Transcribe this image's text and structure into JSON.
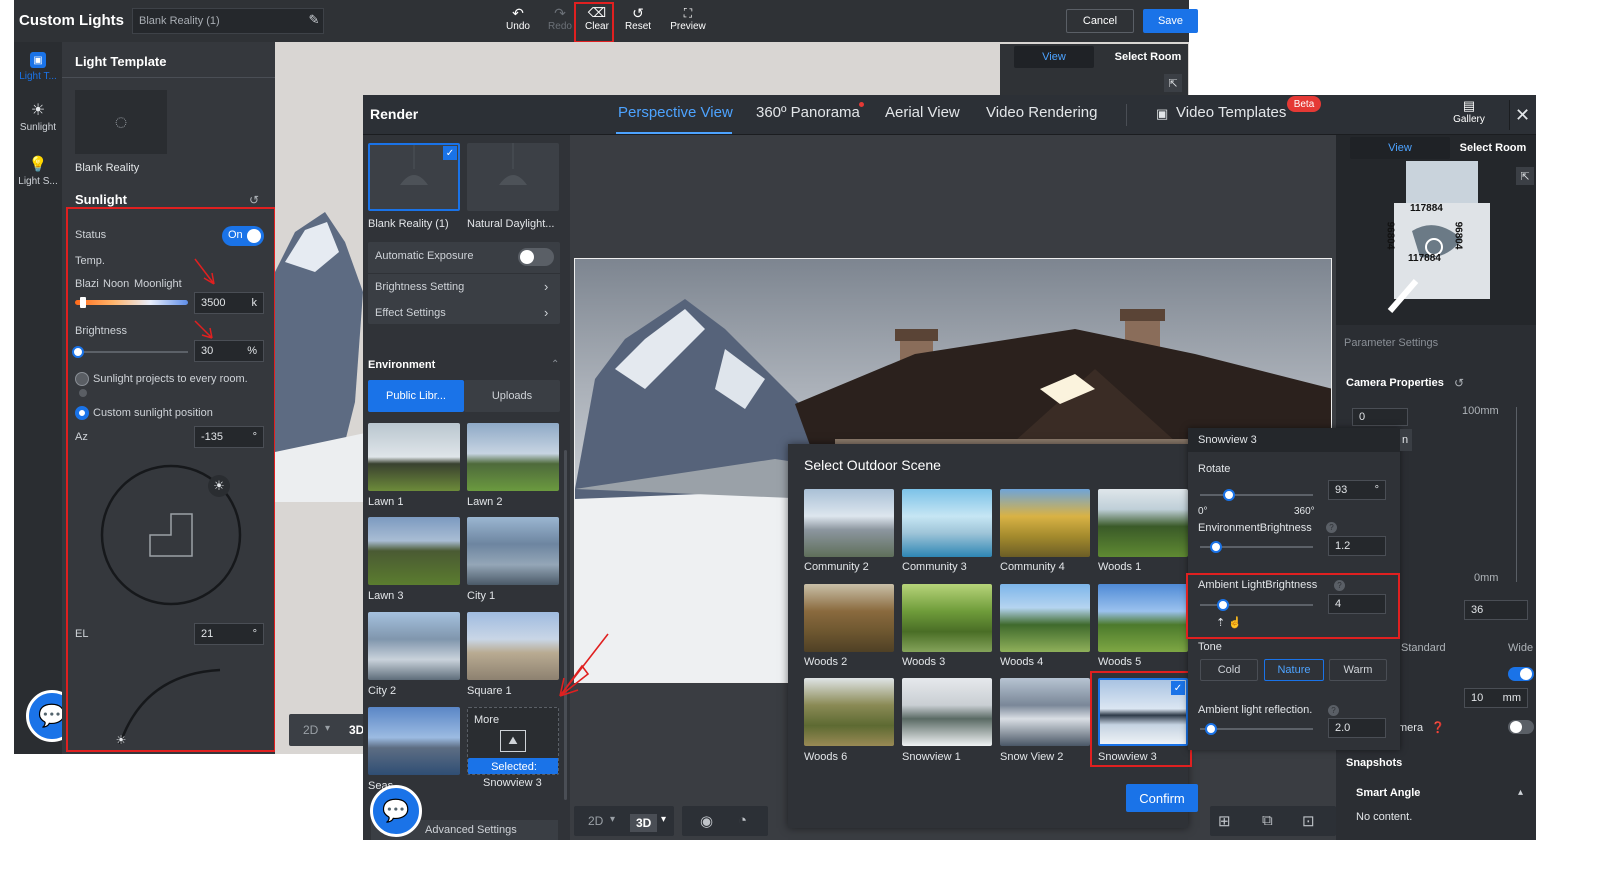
{
  "app": {
    "title": "Custom Lights",
    "scheme_name": "Blank Reality (1)"
  },
  "toolbar": {
    "undo": "Undo",
    "redo": "Redo",
    "clear": "Clear",
    "reset": "Reset",
    "preview": "Preview",
    "cancel": "Cancel",
    "save": "Save"
  },
  "sidebar": {
    "items": [
      {
        "label": "Light T..."
      },
      {
        "label": "Sunlight"
      },
      {
        "label": "Light S..."
      }
    ]
  },
  "left_panel": {
    "template_title": "Light Template",
    "template_name": "Blank Reality",
    "sunlight_title": "Sunlight",
    "status_label": "Status",
    "status_value": "On",
    "temp_label": "Temp.",
    "temp_left": "Blazi",
    "temp_mid": "Noon",
    "temp_right": "Moonlight",
    "temp_value": "3500",
    "temp_unit": "k",
    "brightness_label": "Brightness",
    "brightness_value": "30",
    "brightness_unit": "%",
    "brightness_fraction": 0.0,
    "opt_every_room": "Sunlight projects to every room.",
    "opt_custom": "Custom sunlight position",
    "az_label": "Az",
    "az_value": "-135",
    "az_unit": "°",
    "el_label": "EL",
    "el_value": "21",
    "el_unit": "°"
  },
  "viewport": {
    "view_tab": "View",
    "select_room_tab": "Select Room",
    "mode_2d": "2D",
    "mode_3d": "3D"
  },
  "render": {
    "title": "Render",
    "tabs": [
      {
        "label": "Perspective View",
        "active": true
      },
      {
        "label": "360º Panorama"
      },
      {
        "label": "Aerial View"
      },
      {
        "label": "Video Rendering"
      },
      {
        "label": "Video Templates",
        "badge": "Beta"
      }
    ],
    "gallery": "Gallery",
    "view_tab": "View",
    "select_room_tab": "Select Room",
    "map_labels": [
      "117884",
      "117884",
      "96804",
      "96804"
    ],
    "presets": [
      {
        "label": "Blank Reality (1)",
        "selected": true
      },
      {
        "label": "Natural Daylight..."
      }
    ],
    "auto_exposure": "Automatic Exposure",
    "brightness_setting": "Brightness Setting",
    "effect_settings": "Effect Settings",
    "environment": "Environment",
    "lib_tabs": {
      "public": "Public Libr...",
      "uploads": "Uploads"
    },
    "library": [
      {
        "label": "Lawn 1"
      },
      {
        "label": "Lawn 2"
      },
      {
        "label": "Lawn 3"
      },
      {
        "label": "City 1"
      },
      {
        "label": "City 2"
      },
      {
        "label": "Square 1"
      },
      {
        "label": "Seas..."
      }
    ],
    "more": "More",
    "selected_label": "Selected:",
    "selected_value": "Snowview 3",
    "advanced": "Advanced Settings",
    "bottom": {
      "mode_2d": "2D",
      "mode_3d": "3D"
    }
  },
  "outdoor": {
    "title": "Select Outdoor Scene",
    "scenes": [
      {
        "label": "Community 2"
      },
      {
        "label": "Community 3"
      },
      {
        "label": "Community 4"
      },
      {
        "label": "Woods 1"
      },
      {
        "label": "Woods 2"
      },
      {
        "label": "Woods 3"
      },
      {
        "label": "Woods 4"
      },
      {
        "label": "Woods 5"
      },
      {
        "label": "Woods 6"
      },
      {
        "label": "Snowview 1"
      },
      {
        "label": "Snow View 2"
      },
      {
        "label": "Snowview 3",
        "selected": true
      }
    ],
    "confirm": "Confirm"
  },
  "scene_settings": {
    "title": "Snowview 3",
    "rotate_label": "Rotate",
    "rotate_value": "93",
    "rotate_unit": "°",
    "rotate_min": "0°",
    "rotate_max": "360°",
    "env_label": "EnvironmentBrightness",
    "env_value": "1.2",
    "ambient_label": "Ambient LightBrightness",
    "ambient_value": "4",
    "tone_label": "Tone",
    "tones": [
      {
        "label": "Cold"
      },
      {
        "label": "Nature",
        "active": true
      },
      {
        "label": "Warm"
      }
    ],
    "reflection_label": "Ambient light reflection.",
    "reflection_value": "2.0"
  },
  "params": {
    "title": "Parameter Settings",
    "camera": "Camera Properties",
    "camera_value": "0",
    "ruler_top": "100mm",
    "ruler_bottom": "0mm",
    "focal_value": "36",
    "standard": "Standard",
    "wide": "Wide",
    "dist_value": "10",
    "dist_unit": "mm",
    "camera_suffix": "mera",
    "snapshots": "Snapshots",
    "smart_angle": "Smart Angle",
    "no_content": "No content."
  },
  "colors": {
    "accent": "#1a73e8",
    "highlight": "#e02020",
    "badge": "#e53935"
  }
}
